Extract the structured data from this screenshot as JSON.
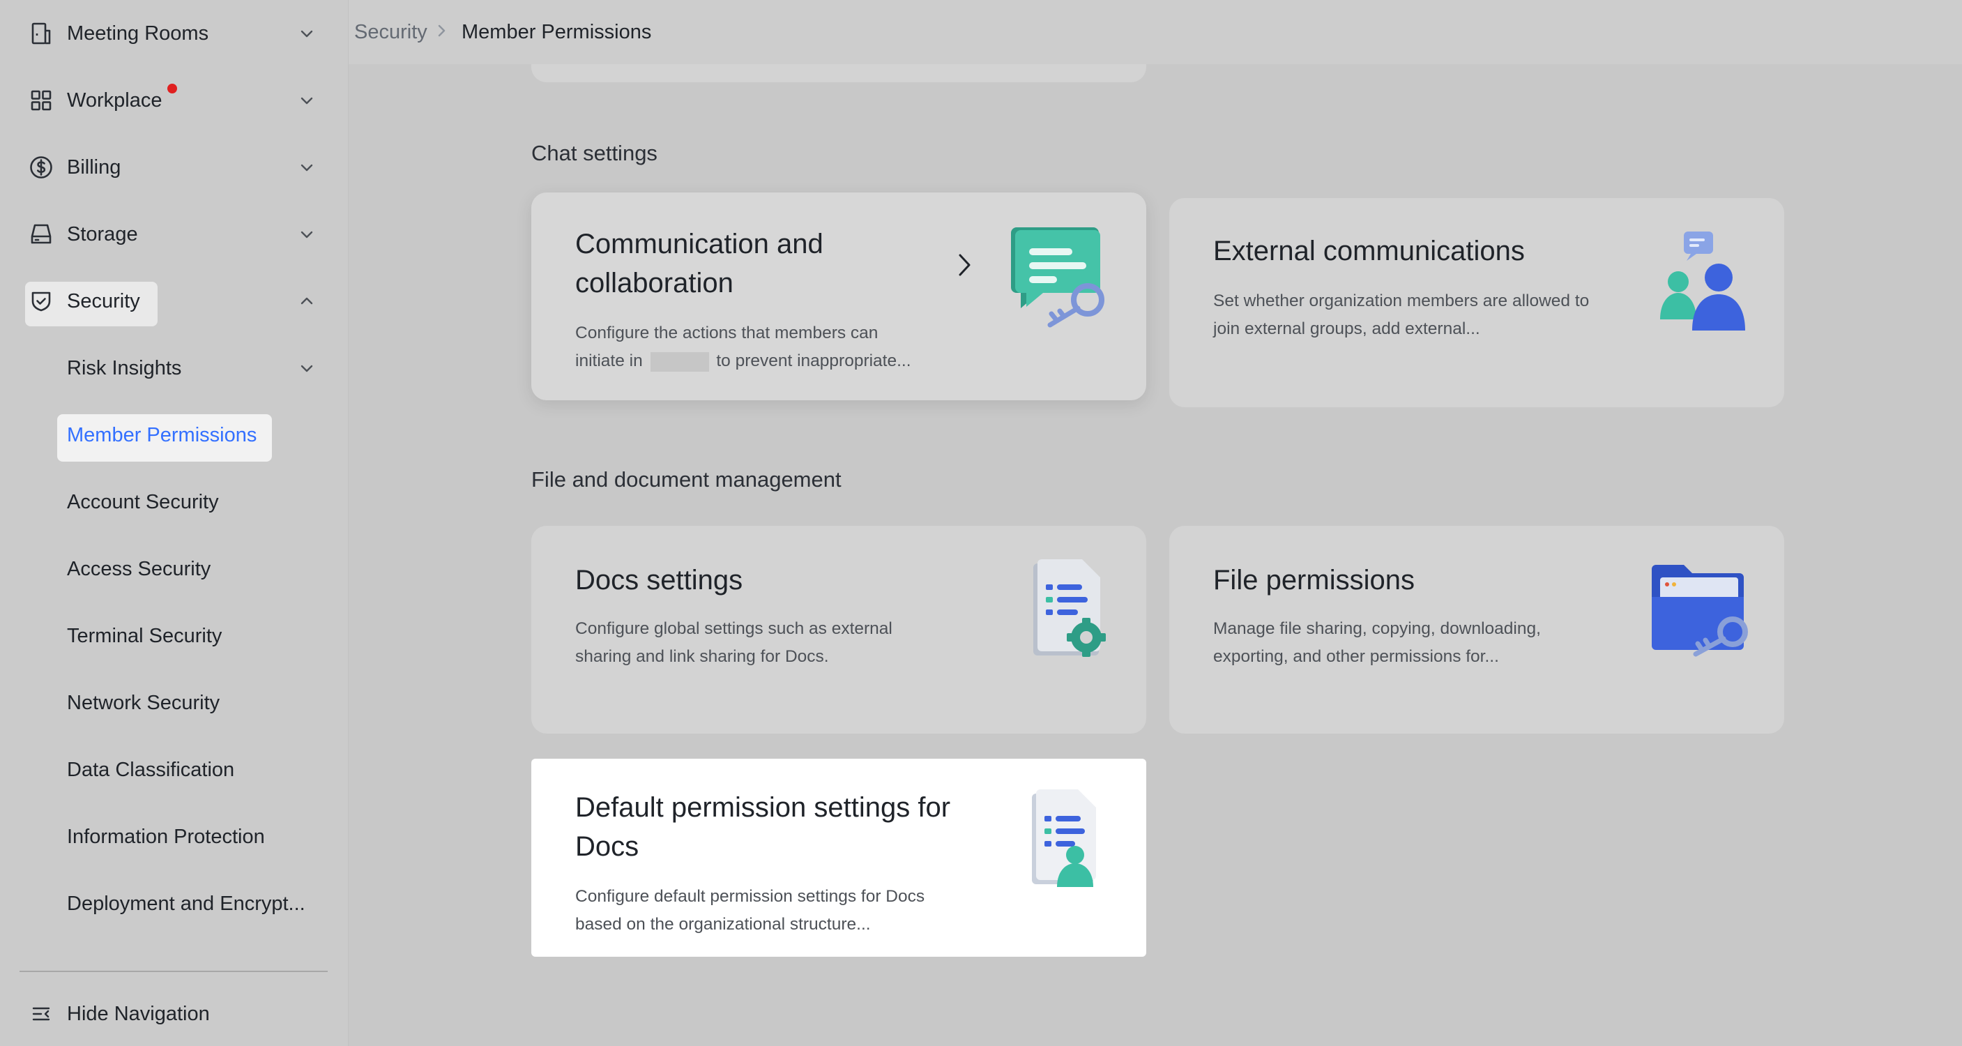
{
  "sidebar": {
    "items": [
      {
        "label": "Meeting Rooms",
        "icon": "building-icon"
      },
      {
        "label": "Workplace",
        "icon": "grid-icon"
      },
      {
        "label": "Billing",
        "icon": "dollar-icon"
      },
      {
        "label": "Storage",
        "icon": "drive-icon"
      },
      {
        "label": "Security",
        "icon": "shield-check-icon"
      }
    ],
    "security_sub": [
      {
        "label": "Risk Insights"
      },
      {
        "label": "Member Permissions"
      },
      {
        "label": "Account Security"
      },
      {
        "label": "Access Security"
      },
      {
        "label": "Terminal Security"
      },
      {
        "label": "Network Security"
      },
      {
        "label": "Data Classification"
      },
      {
        "label": "Information Protection"
      },
      {
        "label": "Deployment and Encrypt..."
      }
    ],
    "hide_nav": "Hide Navigation"
  },
  "breadcrumb": {
    "parent": "Security",
    "separator": ">",
    "current": "Member Permissions"
  },
  "sections": {
    "chat": {
      "title": "Chat settings",
      "cards": [
        {
          "title": "Communication and collaboration",
          "desc_a": "Configure the actions that members can",
          "desc_b_pre": "initiate in",
          "desc_b_post": "to prevent inappropriate..."
        },
        {
          "title": "External communications",
          "desc": "Set whether organization members are allowed to join external groups, add external..."
        }
      ]
    },
    "files": {
      "title": "File and document management",
      "cards": [
        {
          "title": "Docs settings",
          "desc": "Configure global settings such as external sharing and link sharing for Docs."
        },
        {
          "title": "File permissions",
          "desc": "Manage file sharing, copying, downloading, exporting, and other permissions for..."
        },
        {
          "title": "Default permission settings for Docs",
          "desc": "Configure default permission settings for Docs based on the organizational structure..."
        }
      ]
    }
  },
  "colors": {
    "accent": "#3370ff",
    "teal": "#3cbfa4",
    "blue": "#3d63dd",
    "notification": "#e02020"
  }
}
